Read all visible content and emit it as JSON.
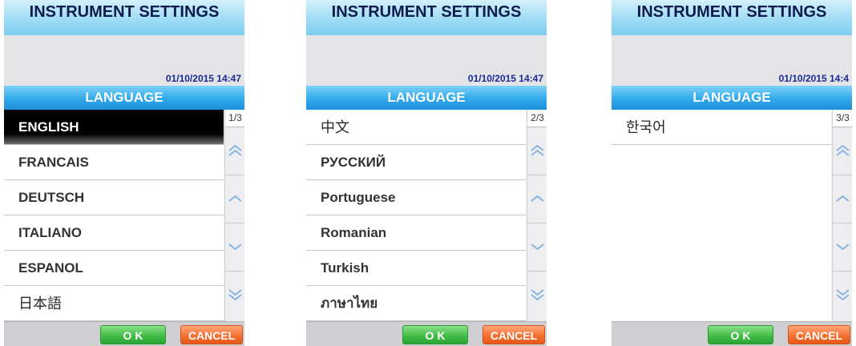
{
  "screens": [
    {
      "title": "INSTRUMENT SETTINGS",
      "timestamp": "01/10/2015 14:47",
      "section": "LANGUAGE",
      "page": "1/3",
      "items": [
        "ENGLISH",
        "FRANCAIS",
        "DEUTSCH",
        "ITALIANO",
        "ESPANOL",
        "日本語"
      ],
      "selected_index": 0,
      "ok_label": "O K",
      "cancel_label": "CANCEL"
    },
    {
      "title": "INSTRUMENT SETTINGS",
      "timestamp": "01/10/2015 14:47",
      "section": "LANGUAGE",
      "page": "2/3",
      "items": [
        "中文",
        "РУССКИЙ",
        "Portuguese",
        "Romanian",
        "Turkish",
        "ภาษาไทย"
      ],
      "ok_label": "O K",
      "cancel_label": "CANCEL"
    },
    {
      "title": "INSTRUMENT SETTINGS",
      "timestamp": "01/10/2015 14:4",
      "section": "LANGUAGE",
      "page": "3/3",
      "items": [
        "한국어"
      ],
      "ok_label": "O K",
      "cancel_label": "CANCEL"
    }
  ],
  "icons": {
    "scroll_top": "double-chevron-up-icon",
    "scroll_up": "chevron-up-icon",
    "scroll_down": "chevron-down-icon",
    "scroll_bottom": "double-chevron-down-icon"
  },
  "colors": {
    "ok": "#3fbb44",
    "cancel": "#f26d2e",
    "header": "#31a9ec",
    "selected_row": "#000000"
  }
}
